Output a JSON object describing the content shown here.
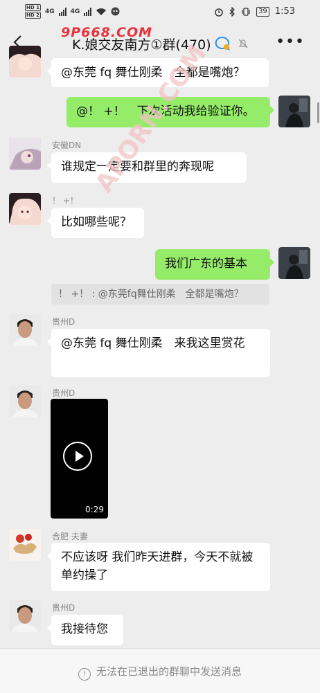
{
  "statusbar": {
    "hd1": "HD 1",
    "hd2": "HD 2",
    "net1": "4G",
    "net2": "4G",
    "battery": "39",
    "time": "1:53"
  },
  "header": {
    "title": "K.娘交友南方①群(470)",
    "watermark_top": "9P668.COM"
  },
  "watermark_diag": "APORN.COM",
  "messages": {
    "m1_text": "@东莞 fq 舞仕刚柔　全都是嘴炮？",
    "m2_text": "@！ +！　下次活动我给验证你。",
    "m3_sender": "安徽DN",
    "m3_text": "谁规定一定要和群里的奔现呢",
    "m4_sender": "！ +！",
    "m4_text": "比如哪些呢？",
    "m5_text": "我们广东的基本",
    "quote_text": "！ +！ : @东莞fq舞仕刚柔　全都是嘴炮？",
    "m6_sender": "贵州D",
    "m6_text": "@东莞 fq 舞仕刚柔　来我这里赏花",
    "m7_sender": "贵州D",
    "m7_duration": "0:29",
    "m8_sender": "合肥 夫妻",
    "m8_text": "不应该呀 我们昨天进群，今天不就被单约操了",
    "m9_sender": "贵州D",
    "m9_text": "我接待您"
  },
  "footer": {
    "notice": "无法在已退出的群聊中发送消息"
  },
  "colors": {
    "bg": "#ededed",
    "bubble_self": "#95ec69",
    "bubble_other": "#ffffff",
    "watermark": "#e81e2b"
  }
}
